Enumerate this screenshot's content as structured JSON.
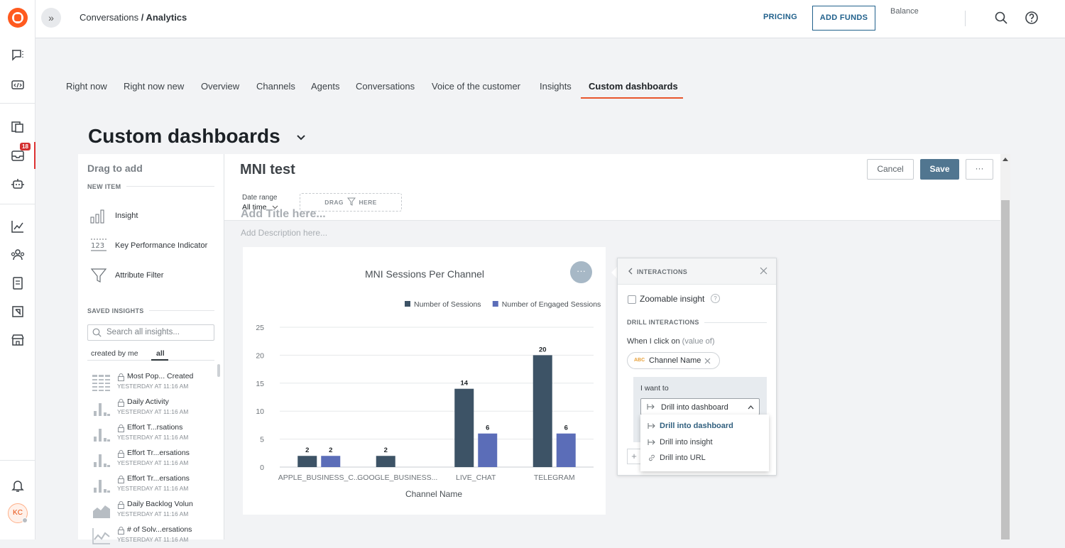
{
  "topbar": {
    "breadcrumb_parent": "Conversations",
    "breadcrumb_sep": " / ",
    "breadcrumb_current": "Analytics",
    "pricing": "PRICING",
    "add_funds": "ADD FUNDS",
    "balance_label": "Balance"
  },
  "sidebar": {
    "notification_badge": "18",
    "avatar_initials": "KC"
  },
  "tabs": [
    "Right now",
    "Right now new",
    "Overview",
    "Channels",
    "Agents",
    "Conversations",
    "Voice of the customer",
    "Insights",
    "Custom dashboards"
  ],
  "active_tab": "Custom dashboards",
  "page_title": "Custom dashboards",
  "left_panel": {
    "heading": "Drag to add",
    "new_item_section": "NEW ITEM",
    "new_items": [
      {
        "label": "Insight",
        "icon": "bar-chart-icon"
      },
      {
        "label": "Key Performance Indicator",
        "icon": "kpi-icon"
      },
      {
        "label": "Attribute Filter",
        "icon": "funnel-icon"
      }
    ],
    "saved_section": "SAVED INSIGHTS",
    "search_placeholder": "Search all insights...",
    "filter_mine": "created by me",
    "filter_all": "all",
    "saved": [
      {
        "name": "Most Pop... Created",
        "date": "YESTERDAY AT 11:16 AM",
        "icon": "table-icon"
      },
      {
        "name": "Daily Activity",
        "date": "YESTERDAY AT 11:16 AM",
        "icon": "bar-chart-icon"
      },
      {
        "name": "Effort T...rsations",
        "date": "YESTERDAY AT 11:16 AM",
        "icon": "bar-chart-icon"
      },
      {
        "name": "Effort Tr...ersations",
        "date": "YESTERDAY AT 11:16 AM",
        "icon": "bar-chart-icon"
      },
      {
        "name": "Effort Tr...ersations",
        "date": "YESTERDAY AT 11:16 AM",
        "icon": "bar-chart-icon"
      },
      {
        "name": "Daily Backlog Volun",
        "date": "YESTERDAY AT 11:16 AM",
        "icon": "area-chart-icon"
      },
      {
        "name": "# of Solv...ersations",
        "date": "YESTERDAY AT 11:16 AM",
        "icon": "line-chart-icon"
      }
    ]
  },
  "dashboard": {
    "name": "MNI test",
    "cancel": "Cancel",
    "save": "Save",
    "more": "···",
    "date_range_label": "Date range",
    "date_range_value": "All time",
    "drop_filter_left": "DRAG",
    "drop_filter_right": "HERE",
    "add_title": "Add Title here...",
    "add_description": "Add Description here..."
  },
  "chart_data": {
    "type": "bar",
    "title": "MNI Sessions Per Channel",
    "xlabel": "Channel Name",
    "ylabel": "",
    "categories": [
      "APPLE_BUSINESS_C...",
      "GOOGLE_BUSINESS...",
      "LIVE_CHAT",
      "TELEGRAM"
    ],
    "series": [
      {
        "name": "Number of Sessions",
        "values": [
          2,
          2,
          14,
          20
        ],
        "color": "#3d5366"
      },
      {
        "name": "Number of Engaged Sessions",
        "values": [
          2,
          null,
          6,
          6
        ],
        "color": "#5b6db8"
      }
    ],
    "ylim": [
      0,
      25
    ],
    "yticks": [
      0,
      5,
      10,
      15,
      20,
      25
    ],
    "legend": "top-right",
    "grid": true
  },
  "interactions": {
    "title": "INTERACTIONS",
    "zoomable_label": "Zoomable insight",
    "drill_section": "DRILL INTERACTIONS",
    "when_click": "When I click on",
    "value_of": "(value of)",
    "chip_type": "ABC",
    "chip_label": "Channel Name",
    "i_want_to": "I want to",
    "selected_action": "Drill into dashboard",
    "options": [
      "Drill into dashboard",
      "Drill into insight",
      "Drill into URL"
    ]
  },
  "colors": {
    "accent": "#e8562c",
    "primary_button": "#517690",
    "series_1": "#3d5366",
    "series_2": "#5b6db8"
  }
}
